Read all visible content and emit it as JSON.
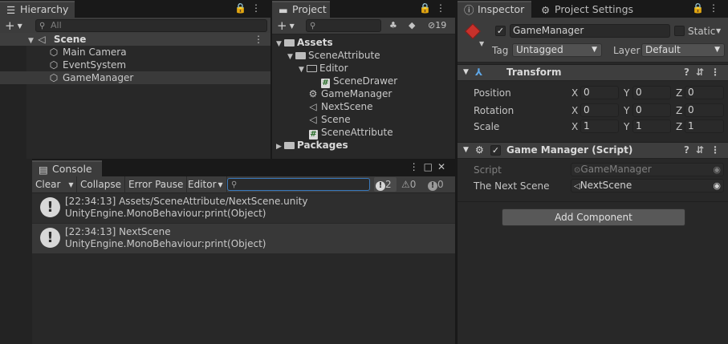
{
  "hierarchy": {
    "tab": "Hierarchy",
    "add": "+",
    "search_placeholder": "All",
    "scene": "Scene",
    "items": [
      "Main Camera",
      "EventSystem",
      "GameManager"
    ]
  },
  "project": {
    "tab": "Project",
    "add": "+",
    "badge": "19",
    "tree": {
      "assets": "Assets",
      "scene_attribute_folder": "SceneAttribute",
      "editor_folder": "Editor",
      "scene_drawer": "SceneDrawer",
      "game_manager": "GameManager",
      "next_scene": "NextScene",
      "scene": "Scene",
      "scene_attribute_script": "SceneAttribute",
      "packages": "Packages"
    }
  },
  "console": {
    "tab": "Console",
    "buttons": {
      "clear": "Clear",
      "collapse": "Collapse",
      "error_pause": "Error Pause",
      "editor": "Editor"
    },
    "counts": {
      "warnings": "2",
      "errors": "0",
      "info": "0"
    },
    "logs": [
      {
        "line1": "[22:34:13] Assets/SceneAttribute/NextScene.unity",
        "line2": "UnityEngine.MonoBehaviour:print(Object)"
      },
      {
        "line1": "[22:34:13] NextScene",
        "line2": "UnityEngine.MonoBehaviour:print(Object)"
      }
    ]
  },
  "inspector": {
    "tabs": [
      "Inspector",
      "Project Settings"
    ],
    "object_name": "GameManager",
    "static_label": "Static",
    "tag_label": "Tag",
    "tag_value": "Untagged",
    "layer_label": "Layer",
    "layer_value": "Default",
    "transform": {
      "title": "Transform",
      "rows": [
        {
          "label": "Position",
          "x": "0",
          "y": "0",
          "z": "0"
        },
        {
          "label": "Rotation",
          "x": "0",
          "y": "0",
          "z": "0"
        },
        {
          "label": "Scale",
          "x": "1",
          "y": "1",
          "z": "1"
        }
      ],
      "axes": [
        "X",
        "Y",
        "Z"
      ]
    },
    "script_component": {
      "title": "Game Manager (Script)",
      "script_label": "Script",
      "script_value": "GameManager",
      "next_scene_label": "The Next Scene",
      "next_scene_value": "NextScene"
    },
    "add_component": "Add Component"
  },
  "colors": {
    "accent_focus": "#3a79bb",
    "gameobject_icon": "#c8312b"
  }
}
